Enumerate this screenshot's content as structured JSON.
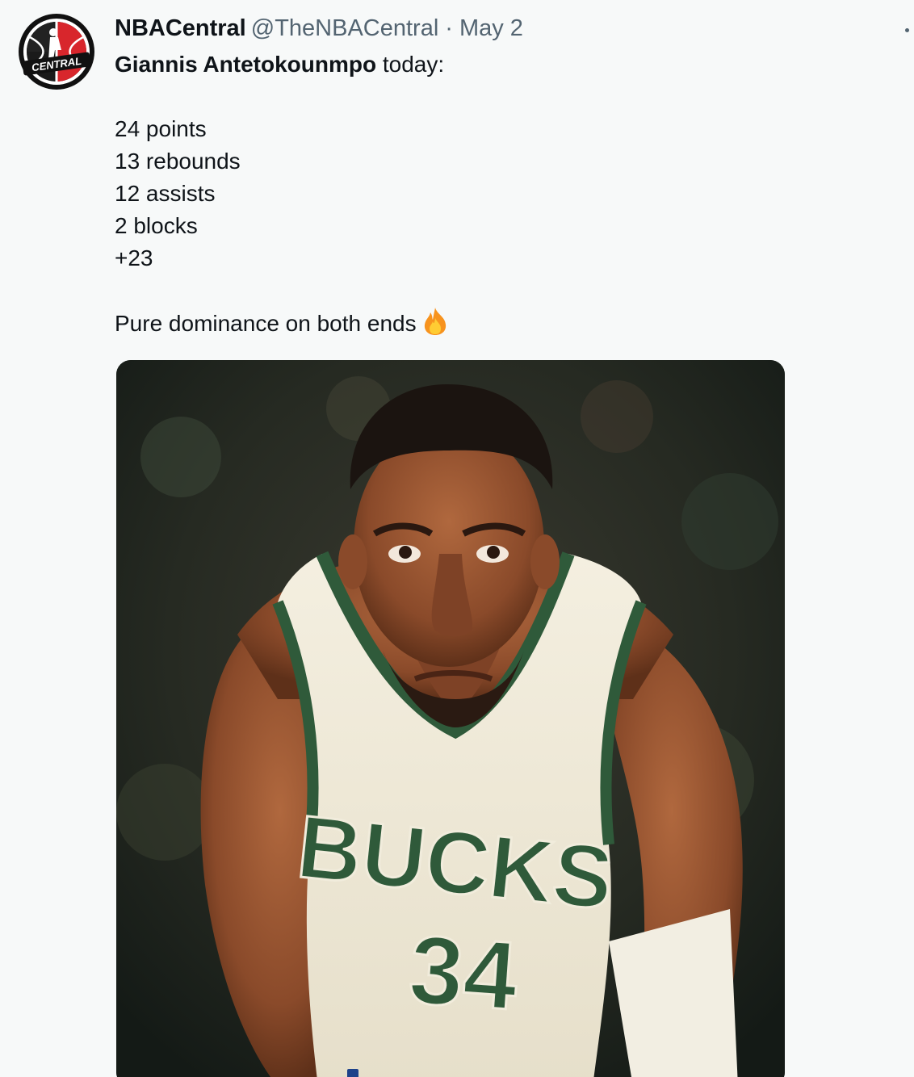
{
  "tweet": {
    "display_name": "NBACentral",
    "handle": "@TheNBACentral",
    "separator": "·",
    "date": "May 2",
    "avatar_icon": "nba-central-logo-icon",
    "avatar_logo_text": "CENTRAL",
    "more_icon": "more-options-icon",
    "text": {
      "lead_bold": "Giannis Antetokounmpo",
      "lead_rest": " today:",
      "stats": [
        "24 points",
        "13 rebounds",
        "12 assists",
        "2 blocks",
        "+23"
      ],
      "closing": "Pure dominance on both ends",
      "closing_emoji": "fire-emoji-icon"
    },
    "media": {
      "jersey_wordmark": "BUCKS",
      "jersey_number": "34"
    }
  },
  "colors": {
    "text_primary": "#0f1419",
    "text_secondary": "#536471",
    "background": "#f7f9f9",
    "logo_red": "#d8262c",
    "bucks_green": "#2f5a3a",
    "jersey_cream": "#f1ecdc"
  }
}
